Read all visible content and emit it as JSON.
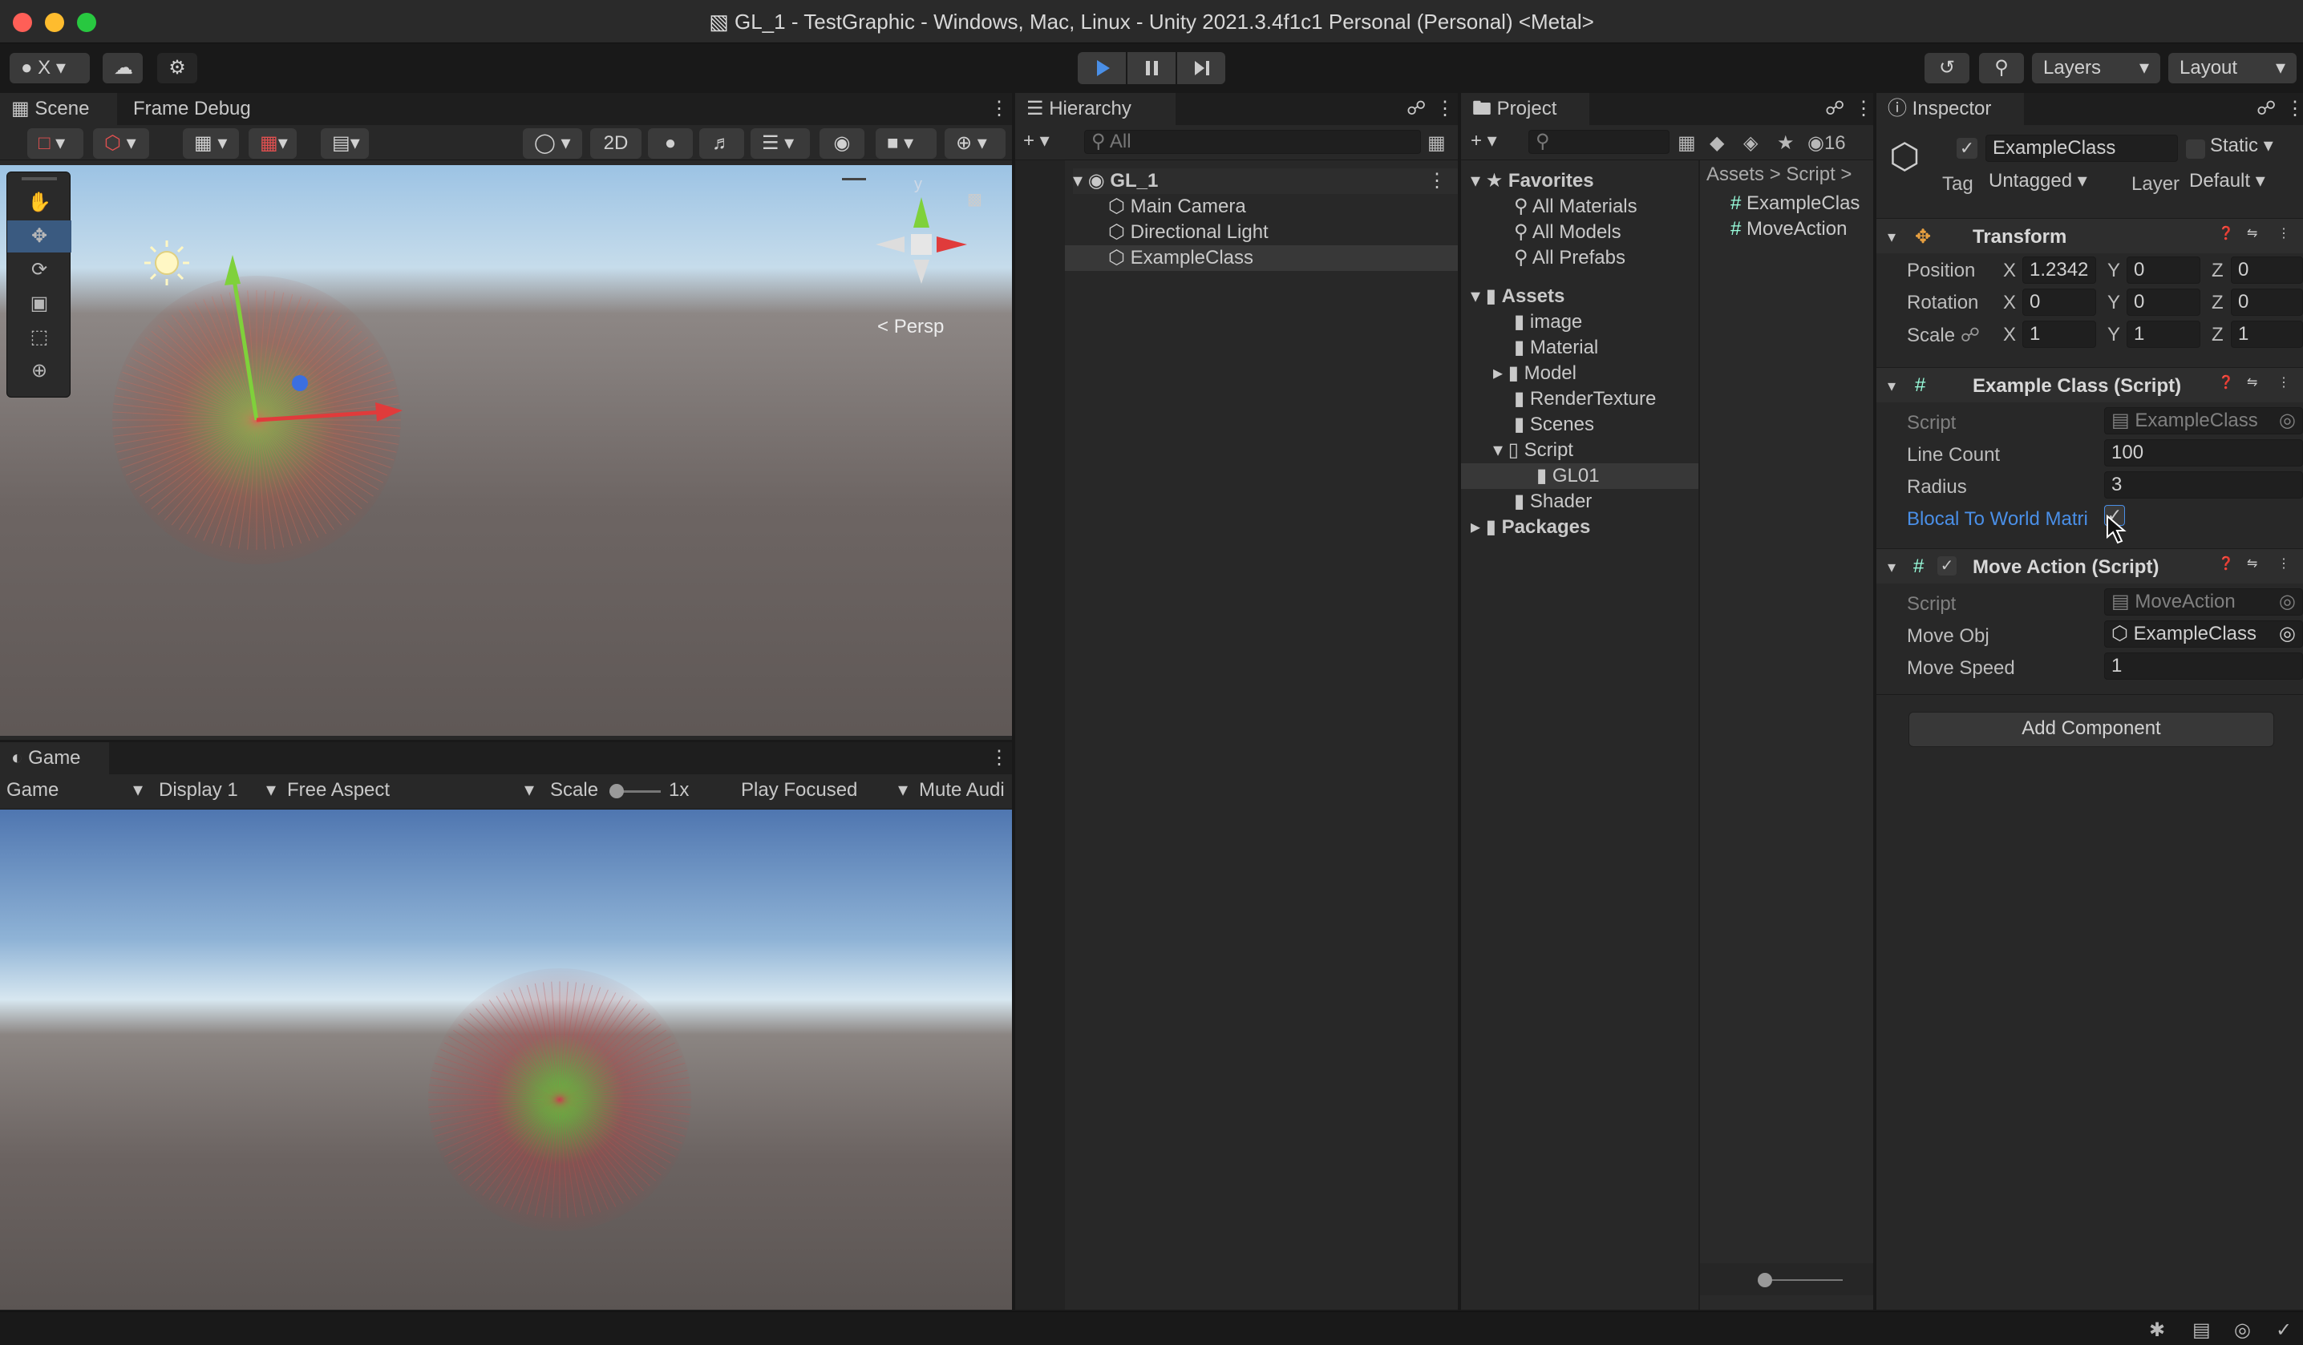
{
  "window": {
    "title": "GL_1 - TestGraphic - Windows, Mac, Linux - Unity 2021.3.4f1c1 Personal (Personal) <Metal>"
  },
  "toolbar": {
    "account_label": "X",
    "layers_label": "Layers",
    "layout_label": "Layout"
  },
  "scene": {
    "tab_scene": "Scene",
    "tab_frame_debug": "Frame Debug",
    "mode_2d": "2D",
    "persp_label": "Persp",
    "gizmo_y": "y"
  },
  "game": {
    "tab_game": "Game",
    "display_mode": "Game",
    "display": "Display 1",
    "aspect": "Free Aspect",
    "scale_label": "Scale",
    "scale_value": "1x",
    "play_mode": "Play Focused",
    "mute": "Mute Audi"
  },
  "hierarchy": {
    "tab": "Hierarchy",
    "search_placeholder": "All",
    "root": "GL_1",
    "items": [
      "Main Camera",
      "Directional Light",
      "ExampleClass"
    ]
  },
  "project": {
    "tab": "Project",
    "hidden_count": "16",
    "favorites_label": "Favorites",
    "favorites": [
      "All Materials",
      "All Models",
      "All Prefabs"
    ],
    "assets_label": "Assets",
    "assets": [
      "image",
      "Material",
      "Model",
      "RenderTexture",
      "Scenes",
      "Script"
    ],
    "script_child": "GL01",
    "after_script": [
      "Shader"
    ],
    "packages_label": "Packages",
    "breadcrumb": [
      "Assets",
      "Script"
    ],
    "files": [
      "ExampleClas",
      "MoveAction"
    ]
  },
  "inspector": {
    "tab": "Inspector",
    "object_name": "ExampleClass",
    "static_label": "Static",
    "tag_label": "Tag",
    "tag_value": "Untagged",
    "layer_label": "Layer",
    "layer_value": "Default",
    "transform": {
      "title": "Transform",
      "position_label": "Position",
      "rotation_label": "Rotation",
      "scale_label": "Scale",
      "position": [
        "1.2342",
        "0",
        "0"
      ],
      "rotation": [
        "0",
        "0",
        "0"
      ],
      "scale": [
        "1",
        "1",
        "1"
      ],
      "x": "X",
      "y": "Y",
      "z": "Z"
    },
    "example_class": {
      "title": "Example Class (Script)",
      "script_label": "Script",
      "script_value": "ExampleClass",
      "line_count_label": "Line Count",
      "line_count": "100",
      "radius_label": "Radius",
      "radius": "3",
      "blocal_label": "Blocal To World Matri"
    },
    "move_action": {
      "title": "Move Action (Script)",
      "script_label": "Script",
      "script_value": "MoveAction",
      "move_obj_label": "Move Obj",
      "move_obj_value": "ExampleClass",
      "move_speed_label": "Move Speed",
      "move_speed": "1"
    },
    "add_component": "Add Component"
  },
  "colors": {
    "accent_blue": "#4a8fe7",
    "x_axis": "#e03b3b",
    "y_axis": "#7fd13b",
    "z_axis": "#3b6fe0"
  }
}
